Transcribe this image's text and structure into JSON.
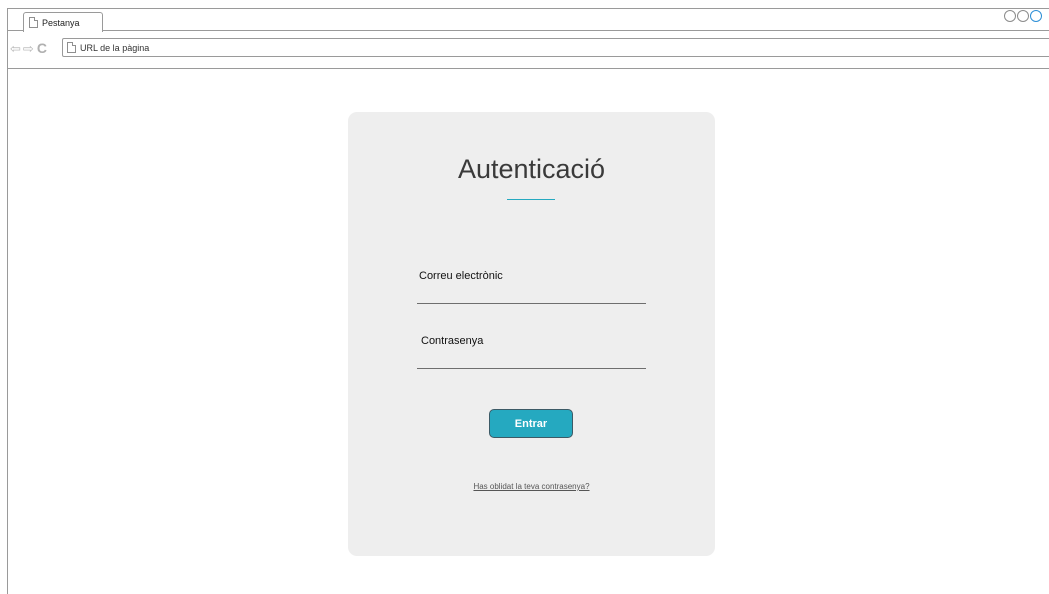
{
  "browser": {
    "tab_label": "Pestanya",
    "url_placeholder": "URL de la pàgina",
    "nav": {
      "back_icon": "back-arrow-icon",
      "forward_icon": "forward-arrow-icon",
      "reload_icon": "reload-icon"
    }
  },
  "login": {
    "title": "Autenticació",
    "email_label": "Correu electrònic",
    "password_label": "Contrasenya",
    "submit_label": "Entrar",
    "forgot_link": "Has oblidat la teva contrasenya?"
  },
  "colors": {
    "accent": "#25a9c0",
    "card_background": "#eeeeee",
    "window_control_accent": "#2d8fd6"
  }
}
